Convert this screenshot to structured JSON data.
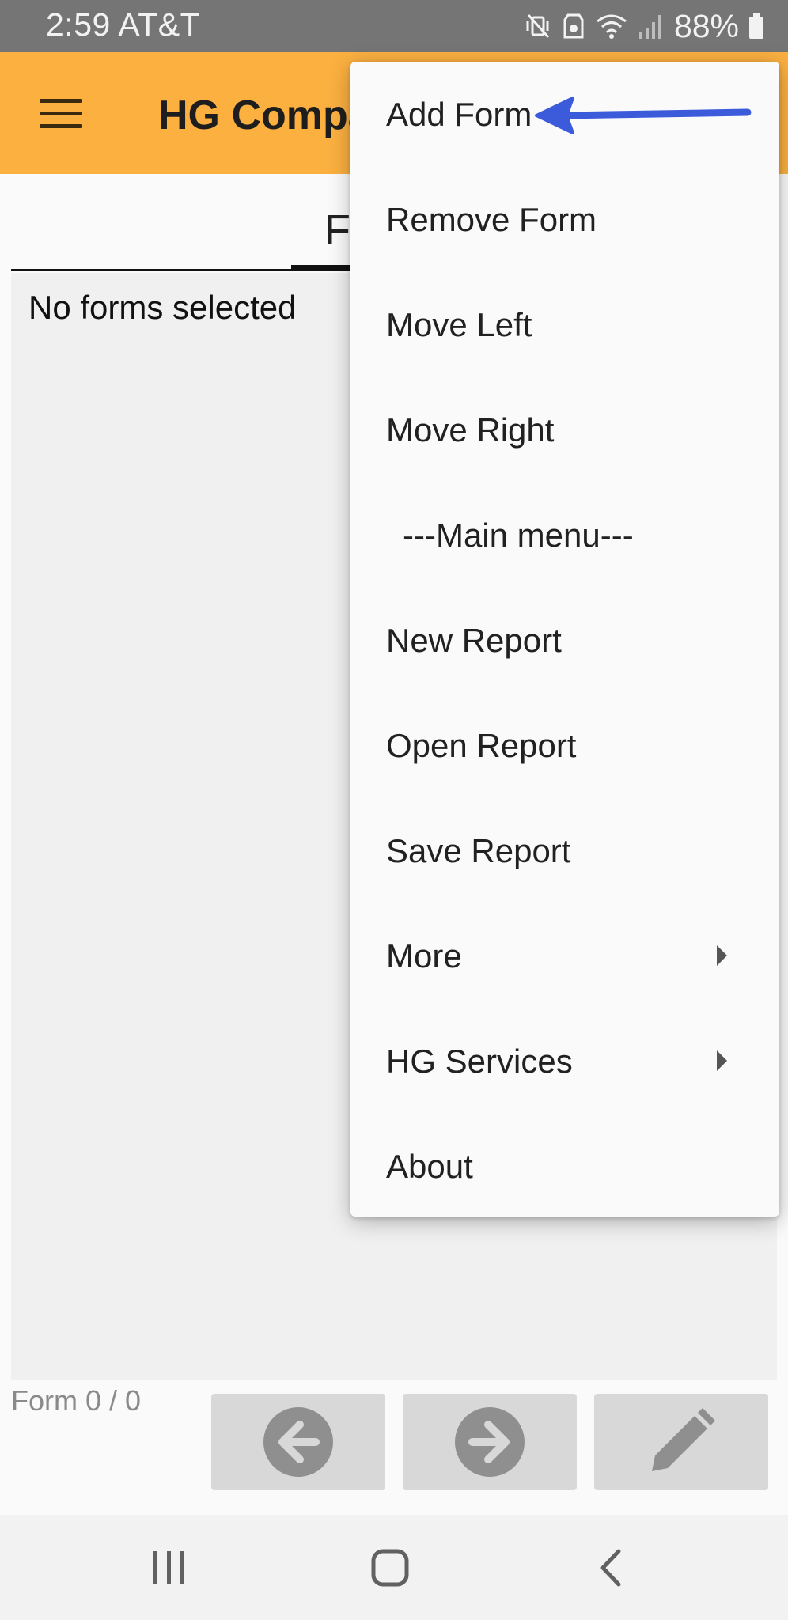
{
  "status_bar": {
    "time_carrier": "2:59 AT&T",
    "battery": "88%",
    "icons": [
      "vibrate-mute-icon",
      "data-saver-icon",
      "wifi-icon",
      "signal-icon",
      "battery-icon"
    ]
  },
  "app_bar": {
    "title": "HG Compa",
    "menu_icon": "hamburger-menu-icon"
  },
  "tab": {
    "label": "F"
  },
  "content": {
    "empty_message": "No forms selected",
    "form_counter": "Form 0 / 0"
  },
  "nav_buttons": [
    "previous-arrow-icon",
    "next-arrow-icon",
    "edit-pencil-icon"
  ],
  "overflow_menu": {
    "items": [
      {
        "label": "Add Form"
      },
      {
        "label": "Remove Form"
      },
      {
        "label": "Move Left"
      },
      {
        "label": "Move Right"
      },
      {
        "label": "---Main menu---"
      },
      {
        "label": "New Report"
      },
      {
        "label": "Open Report"
      },
      {
        "label": "Save Report"
      },
      {
        "label": "More",
        "submenu": true
      },
      {
        "label": "HG Services",
        "submenu": true
      },
      {
        "label": "About"
      }
    ]
  },
  "annotation": {
    "arrow_color": "#3b5bdb",
    "points_to": "Add Form"
  },
  "colors": {
    "app_bar": "#fbb040",
    "status_bar": "#757575"
  },
  "system_nav": [
    "recent-apps-icon",
    "home-icon",
    "back-icon"
  ]
}
